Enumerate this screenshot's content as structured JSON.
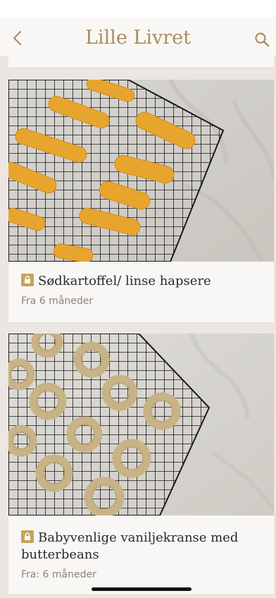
{
  "header": {
    "title": "Lille Livret",
    "back_icon": "chevron-left-icon",
    "search_icon": "search-icon"
  },
  "colors": {
    "accent": "#a88e5e",
    "lock_badge": "#c5a45d"
  },
  "recipes": [
    {
      "title": "Sødkartoffel/ linse hapsere",
      "age": "Fra 6 måneder",
      "locked": true,
      "image": "sweet-potato-sticks-on-cooling-rack"
    },
    {
      "title": "Babyvenlige vaniljekranse med butterbeans",
      "age": "Fra: 6 måneder",
      "locked": true,
      "image": "vanilla-ring-cookies-on-cooling-rack"
    }
  ]
}
